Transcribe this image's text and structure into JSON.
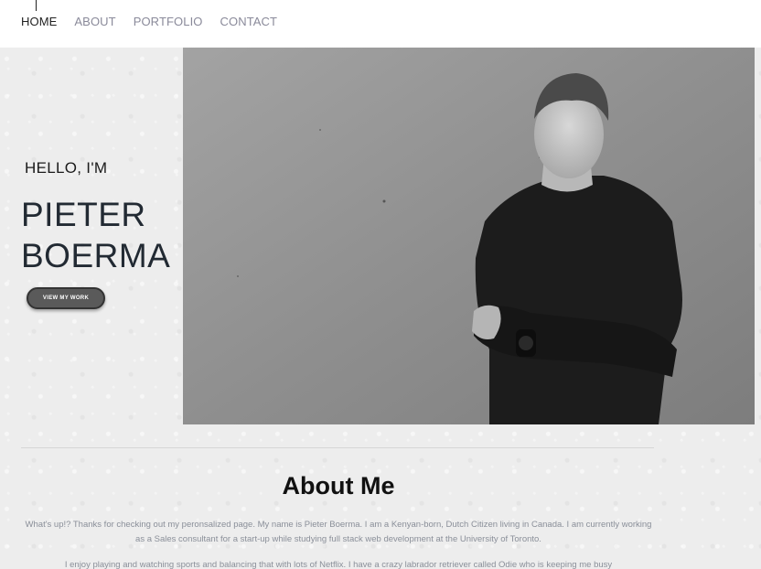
{
  "nav": {
    "items": [
      {
        "label": "HOME",
        "active": true
      },
      {
        "label": "ABOUT",
        "active": false
      },
      {
        "label": "PORTFOLIO",
        "active": false
      },
      {
        "label": "CONTACT",
        "active": false
      }
    ]
  },
  "hero": {
    "greeting": "HELLO, I'M",
    "first_name": "PIETER",
    "last_name": "BOERMA",
    "cta_label": "VIEW MY WORK",
    "cta_color": "#5a5a5a"
  },
  "about": {
    "title": "About Me",
    "paragraph_1": "What's up!? Thanks for checking out my peronsalized page. My name is Pieter Boerma. I am a Kenyan-born, Dutch Citizen living in Canada. I am currently working as a Sales consultant for a start-up while studying full stack web development at the University of Toronto.",
    "paragraph_2": "I enjoy playing and watching sports and balancing that with lots of Netflix. I have a crazy labrador retriever called Odie who is keeping me busy"
  },
  "colors": {
    "nav_active": "#222222",
    "nav_inactive": "#8a8a9a",
    "background": "#ededed",
    "body_text": "#8a8f99"
  }
}
